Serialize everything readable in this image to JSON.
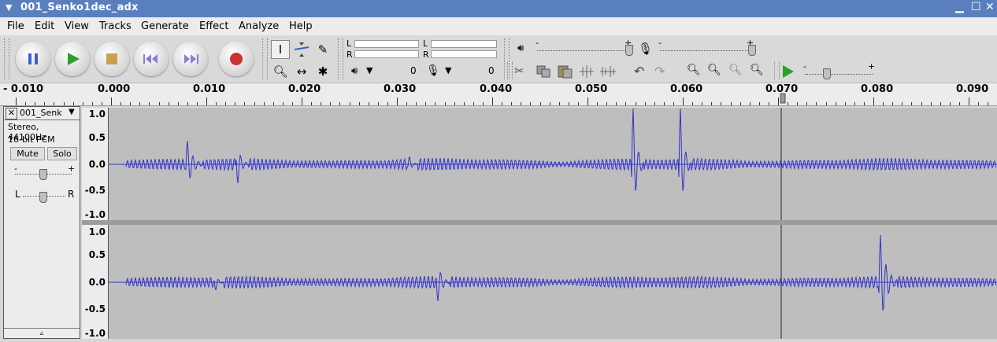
{
  "window": {
    "title": "001_Senko1dec_adx",
    "menu_icon": "triangle-down-icon",
    "minimize": "minimize-icon",
    "maximize": "maximize-icon",
    "close": "close-icon"
  },
  "menu": [
    "File",
    "Edit",
    "View",
    "Tracks",
    "Generate",
    "Effect",
    "Analyze",
    "Help"
  ],
  "transport": [
    "pause-icon",
    "play-icon",
    "stop-icon",
    "skip-to-start-icon",
    "skip-to-end-icon",
    "record-icon"
  ],
  "tools": [
    "selection-tool-icon",
    "envelope-tool-icon",
    "draw-tool-icon",
    "zoom-tool-icon",
    "time-shift-tool-icon",
    "multi-tool-icon"
  ],
  "meters": {
    "playback": {
      "left_label": "L",
      "right_label": "R",
      "value": "0"
    },
    "record": {
      "left_label": "L",
      "right_label": "R",
      "value": "0"
    }
  },
  "mixer": {
    "minus": "-",
    "plus": "+"
  },
  "play_at_speed": {
    "minus": "-",
    "plus": "+"
  },
  "ruler": [
    "- 0.010",
    "0.000",
    "0.010",
    "0.020",
    "0.030",
    "0.040",
    "0.050",
    "0.060",
    "0.070",
    "0.080",
    "0.090"
  ],
  "track": {
    "name": "001_Senk",
    "format": "Stereo, 44100Hz",
    "bits": "16-bit PCM",
    "mute": "Mute",
    "solo": "Solo",
    "pan_left": "L",
    "pan_right": "R",
    "gain_minus": "-",
    "gain_plus": "+",
    "collapse": "collapse-arrow-icon"
  },
  "vscale": [
    "1.0",
    "0.5",
    "0.0",
    "-0.5",
    "-1.0"
  ],
  "colors": {
    "title_bar": "#5a7fbf",
    "waveform": "#3232c8",
    "wave_bg": "#bebebe",
    "record_red": "#c83232",
    "play_green": "#2aa02a"
  }
}
